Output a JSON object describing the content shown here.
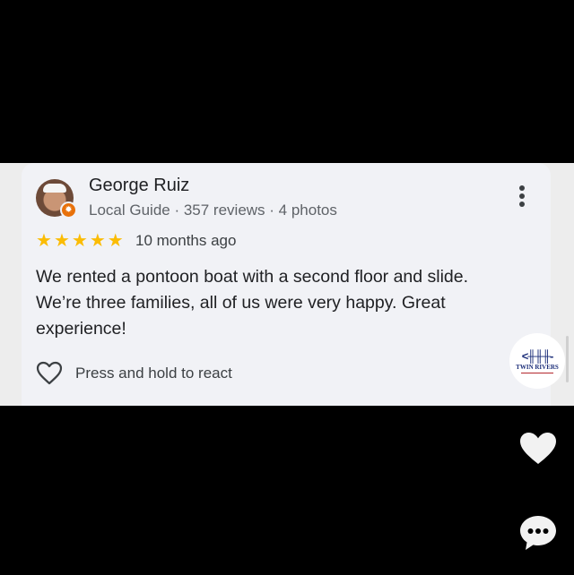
{
  "review": {
    "author": "George Ruiz",
    "meta": "Local Guide · 357 reviews · 4 photos",
    "rating": 5,
    "time": "10 months ago",
    "text": "We rented a pontoon boat with a second floor and slide. We’re three families, all of us were very happy. Great experience!",
    "react_label": "Press and hold to react"
  },
  "logo": {
    "text": "TWIN RIVERS"
  },
  "colors": {
    "star": "#fbbc04",
    "brand": "#1d2f7a",
    "card": "#f1f2f6"
  },
  "icons": {
    "more": "more-vert-icon",
    "heart": "heart-outline-icon",
    "like": "heart-icon",
    "comment": "comment-icon"
  }
}
